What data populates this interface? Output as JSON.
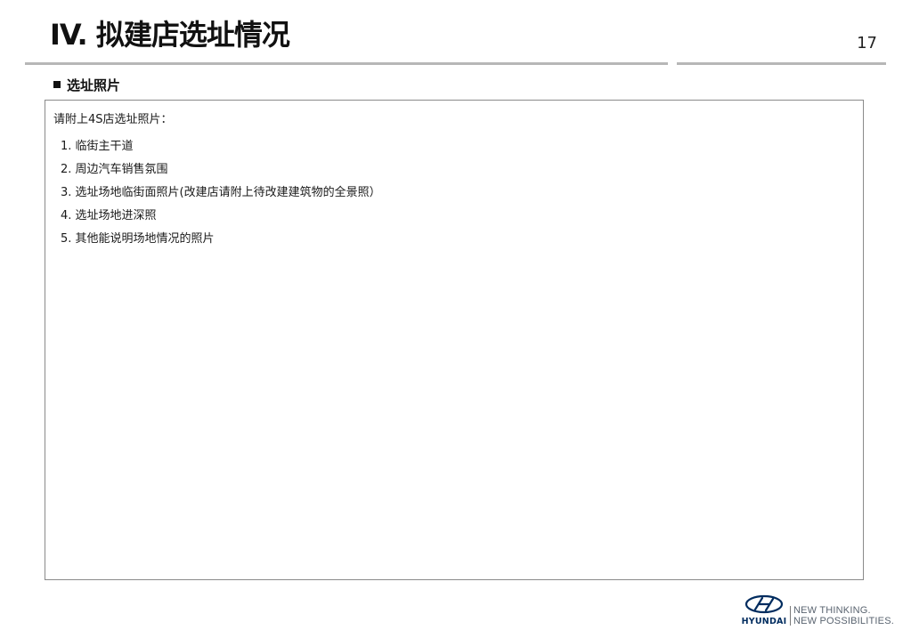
{
  "header": {
    "title": "IV. 拟建店选址情况",
    "page_number": "17"
  },
  "section": {
    "heading": "选址照片"
  },
  "content": {
    "intro": "请附上4S店选址照片：",
    "items": [
      "1. 临街主干道",
      "2. 周边汽车销售氛围",
      "3. 选址场地临街面照片(改建店请附上待改建建筑物的全景照）",
      "4. 选址场地进深照",
      "5. 其他能说明场地情况的照片"
    ]
  },
  "footer": {
    "brand": "HYUNDAI",
    "tagline_line1": "NEW THINKING.",
    "tagline_line2": "NEW POSSIBILITIES.",
    "brand_color": "#002c5f",
    "tagline_color": "#5a6470"
  }
}
